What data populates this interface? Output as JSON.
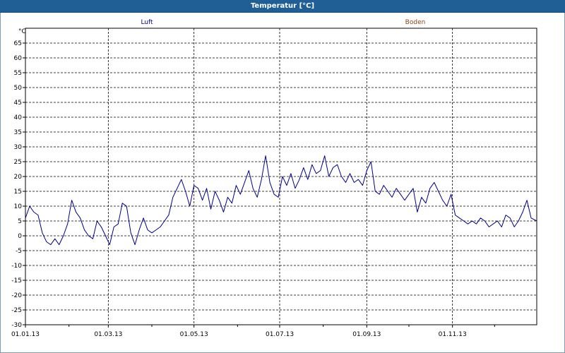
{
  "window": {
    "title": "Temperatur [°C]"
  },
  "colors": {
    "titlebar": "#1f5f96",
    "luft": "#00008b",
    "boden": "#8b4513",
    "grid": "#000000"
  },
  "chart_data": {
    "type": "line",
    "title": "Temperatur [°C]",
    "ylabel": "°C",
    "ylim": [
      -30,
      70
    ],
    "yticks": [
      -30,
      -25,
      -20,
      -15,
      -10,
      -5,
      0,
      5,
      10,
      15,
      20,
      25,
      30,
      35,
      40,
      45,
      50,
      55,
      60,
      65
    ],
    "xlim": [
      "2013-01-01",
      "2013-12-31"
    ],
    "xticks": [
      {
        "date": "2013-01-01",
        "label": "01.01.13"
      },
      {
        "date": "2013-03-01",
        "label": "01.03.13"
      },
      {
        "date": "2013-05-01",
        "label": "01.05.13"
      },
      {
        "date": "2013-07-01",
        "label": "01.07.13"
      },
      {
        "date": "2013-09-01",
        "label": "01.09.13"
      },
      {
        "date": "2013-11-01",
        "label": "01.11.13"
      }
    ],
    "grid": true,
    "legend": [
      "Luft",
      "Boden"
    ],
    "series": [
      {
        "name": "Luft",
        "x": [
          "2013-01-01",
          "2013-01-04",
          "2013-01-07",
          "2013-01-10",
          "2013-01-13",
          "2013-01-16",
          "2013-01-19",
          "2013-01-22",
          "2013-01-25",
          "2013-01-28",
          "2013-01-31",
          "2013-02-03",
          "2013-02-06",
          "2013-02-09",
          "2013-02-12",
          "2013-02-15",
          "2013-02-18",
          "2013-02-21",
          "2013-02-24",
          "2013-02-27",
          "2013-03-02",
          "2013-03-05",
          "2013-03-08",
          "2013-03-11",
          "2013-03-14",
          "2013-03-17",
          "2013-03-20",
          "2013-03-23",
          "2013-03-26",
          "2013-03-29",
          "2013-04-01",
          "2013-04-04",
          "2013-04-07",
          "2013-04-10",
          "2013-04-13",
          "2013-04-16",
          "2013-04-19",
          "2013-04-22",
          "2013-04-25",
          "2013-04-28",
          "2013-05-01",
          "2013-05-04",
          "2013-05-07",
          "2013-05-10",
          "2013-05-13",
          "2013-05-16",
          "2013-05-19",
          "2013-05-22",
          "2013-05-25",
          "2013-05-28",
          "2013-05-31",
          "2013-06-03",
          "2013-06-06",
          "2013-06-09",
          "2013-06-12",
          "2013-06-15",
          "2013-06-18",
          "2013-06-21",
          "2013-06-24",
          "2013-06-27",
          "2013-06-30",
          "2013-07-03",
          "2013-07-06",
          "2013-07-09",
          "2013-07-12",
          "2013-07-15",
          "2013-07-18",
          "2013-07-21",
          "2013-07-24",
          "2013-07-27",
          "2013-07-30",
          "2013-08-02",
          "2013-08-05",
          "2013-08-08",
          "2013-08-11",
          "2013-08-14",
          "2013-08-17",
          "2013-08-20",
          "2013-08-23",
          "2013-08-26",
          "2013-08-29",
          "2013-09-01",
          "2013-09-04",
          "2013-09-07",
          "2013-09-10",
          "2013-09-13",
          "2013-09-16",
          "2013-09-19",
          "2013-09-22",
          "2013-09-25",
          "2013-09-28",
          "2013-10-01",
          "2013-10-04",
          "2013-10-07",
          "2013-10-10",
          "2013-10-13",
          "2013-10-16",
          "2013-10-19",
          "2013-10-22",
          "2013-10-25",
          "2013-10-28",
          "2013-10-31",
          "2013-11-03",
          "2013-11-06",
          "2013-11-09",
          "2013-11-12",
          "2013-11-15",
          "2013-11-18",
          "2013-11-21",
          "2013-11-24",
          "2013-11-27",
          "2013-11-30",
          "2013-12-03",
          "2013-12-06",
          "2013-12-09",
          "2013-12-12",
          "2013-12-15",
          "2013-12-18",
          "2013-12-21",
          "2013-12-24",
          "2013-12-27",
          "2013-12-31"
        ],
        "values": [
          6,
          10,
          8,
          7,
          1,
          -2,
          -3,
          -1,
          -3,
          0,
          4,
          12,
          8,
          6,
          2,
          0,
          -1,
          5,
          3,
          0,
          -3,
          3,
          4,
          11,
          10,
          1,
          -3,
          2,
          6,
          2,
          1,
          2,
          3,
          5,
          7,
          13,
          16,
          19,
          15,
          10,
          17,
          16,
          12,
          16,
          9,
          15,
          12,
          8,
          13,
          11,
          17,
          14,
          18,
          22,
          16,
          13,
          19,
          27,
          18,
          14,
          13,
          20,
          17,
          21,
          16,
          19,
          23,
          19,
          24,
          21,
          22,
          27,
          20,
          23,
          24,
          20,
          18,
          21,
          18,
          19,
          17,
          22,
          25,
          15,
          14,
          17,
          15,
          13,
          16,
          14,
          12,
          14,
          16,
          8,
          13,
          11,
          16,
          18,
          15,
          12,
          10,
          14,
          7,
          6,
          5,
          4,
          5,
          4,
          6,
          5,
          3,
          4,
          5,
          3,
          7,
          6,
          3,
          5,
          8,
          12,
          6,
          5
        ]
      },
      {
        "name": "Boden",
        "x": [],
        "values": []
      }
    ]
  }
}
